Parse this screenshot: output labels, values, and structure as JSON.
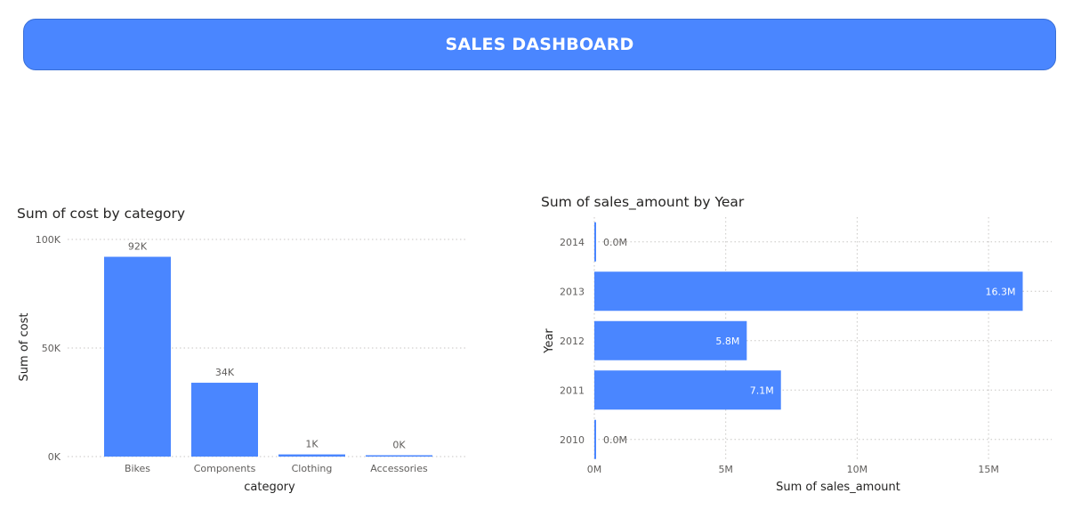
{
  "header": {
    "title": "SALES DASHBOARD"
  },
  "colors": {
    "bar": "#4a86ff",
    "header_bg": "#4a86ff"
  },
  "chart_data": [
    {
      "type": "bar",
      "title": "Sum of cost by category",
      "xlabel": "category",
      "ylabel": "Sum of cost",
      "categories": [
        "Bikes",
        "Components",
        "Clothing",
        "Accessories"
      ],
      "values": [
        92000,
        34000,
        1000,
        400
      ],
      "data_labels": [
        "92K",
        "34K",
        "1K",
        "0K"
      ],
      "ylim": [
        0,
        100000
      ],
      "yticks": [
        0,
        50000,
        100000
      ],
      "ytick_labels": [
        "0K",
        "50K",
        "100K"
      ],
      "grid": true
    },
    {
      "type": "bar",
      "orientation": "horizontal",
      "title": "Sum of sales_amount by Year",
      "xlabel": "Sum of sales_amount",
      "ylabel": "Year",
      "categories": [
        "2014",
        "2013",
        "2012",
        "2011",
        "2010"
      ],
      "values": [
        0.02,
        16.3,
        5.8,
        7.1,
        0.02
      ],
      "data_labels": [
        "0.0M",
        "16.3M",
        "5.8M",
        "7.1M",
        "0.0M"
      ],
      "xlim": [
        0,
        17.4
      ],
      "xticks": [
        0,
        5,
        10,
        15
      ],
      "xtick_labels": [
        "0M",
        "5M",
        "10M",
        "15M"
      ],
      "grid": true
    }
  ]
}
